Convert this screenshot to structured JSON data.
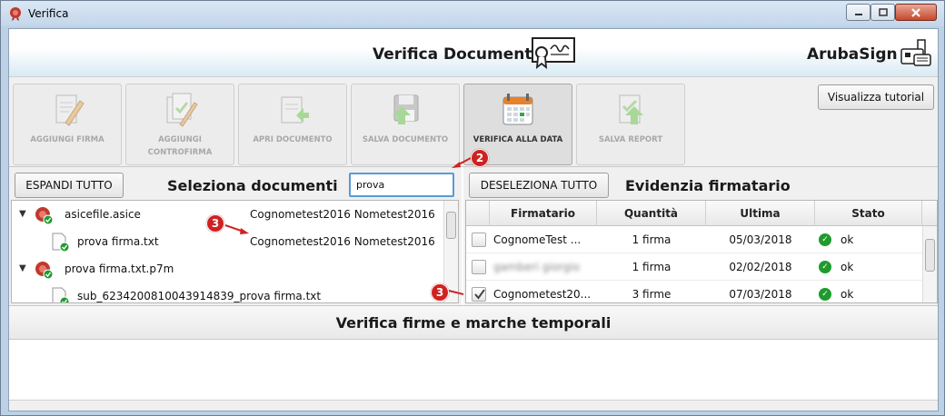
{
  "window": {
    "title": "Verifica"
  },
  "header": {
    "title": "Verifica Documenti",
    "brand": "ArubaSign"
  },
  "toolbar": {
    "buttons": [
      {
        "label": "AGGIUNGI FIRMA",
        "icon": "pen-document-icon",
        "enabled": false
      },
      {
        "label": "AGGIUNGI CONTROFIRMA",
        "icon": "countersign-icon",
        "enabled": false
      },
      {
        "label": "APRI DOCUMENTO",
        "icon": "open-document-icon",
        "enabled": false
      },
      {
        "label": "SALVA DOCUMENTO",
        "icon": "floppy-disk-icon",
        "enabled": false
      },
      {
        "label": "VERIFICA ALLA DATA",
        "icon": "calendar-icon",
        "enabled": true
      },
      {
        "label": "SALVA REPORT",
        "icon": "save-report-icon",
        "enabled": false
      }
    ],
    "tutorial_label": "Visualizza tutorial"
  },
  "left": {
    "expand_label": "ESPANDI TUTTO",
    "title": "Seleziona documenti",
    "search_value": "prova",
    "tree": [
      {
        "name": "asicefile.asice",
        "signer": "Cognometest2016 Nometest2016",
        "level": 0,
        "expanded": true
      },
      {
        "name": "prova firma.txt",
        "signer": "Cognometest2016 Nometest2016",
        "level": 1
      },
      {
        "name": "prova firma.txt.p7m",
        "signer": "",
        "level": 0,
        "expanded": true
      },
      {
        "name": "sub_6234200810043914839_prova firma.txt",
        "signer": "",
        "level": 1
      }
    ]
  },
  "right": {
    "deselect_label": "DESELEZIONA TUTTO",
    "title": "Evidenzia firmatario",
    "columns": [
      "Firmatario",
      "Quantità",
      "Ultima",
      "Stato"
    ],
    "rows": [
      {
        "checked": false,
        "signer": "CognomeTest ...",
        "qty": "1 firma",
        "last": "05/03/2018",
        "status": "ok",
        "blurred": false
      },
      {
        "checked": false,
        "signer": "gamberi giorgio",
        "qty": "1 firma",
        "last": "02/02/2018",
        "status": "ok",
        "blurred": true
      },
      {
        "checked": true,
        "signer": "Cognometest20...",
        "qty": "3 firme",
        "last": "07/03/2018",
        "status": "ok",
        "blurred": false
      }
    ]
  },
  "bottom": {
    "title": "Verifica firme e marche temporali"
  },
  "callouts": [
    "2",
    "3",
    "3"
  ],
  "colors": {
    "accent": "#5a9ad6",
    "callout": "#d02121",
    "ok": "#1f9b2e"
  }
}
